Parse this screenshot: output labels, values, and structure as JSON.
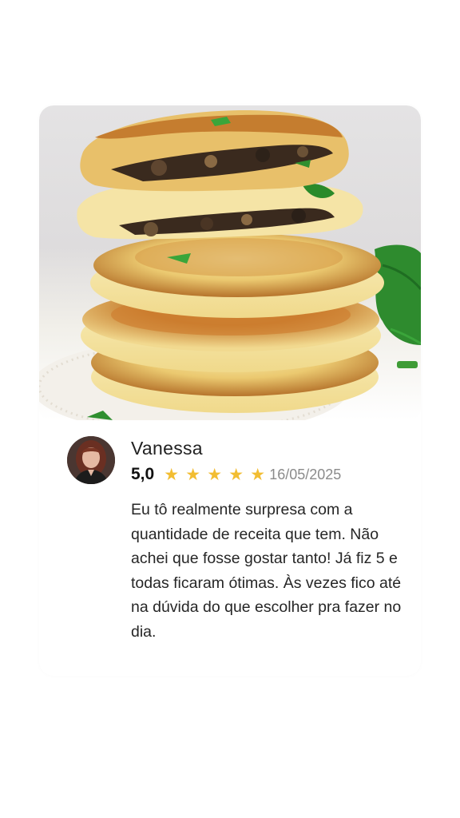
{
  "review_card": {
    "photo": {
      "subject": "stacked stuffed potato patties"
    },
    "reviewer": {
      "name": "Vanessa",
      "avatar_icon": "reviewer-avatar"
    },
    "rating": {
      "score_label": "5,0",
      "stars": 5,
      "max_stars": 5,
      "star_glyph": "★",
      "star_color": "#f2bd32"
    },
    "date": "16/05/2025",
    "text": "Eu tô realmente surpresa com a quantidade de receita que tem. Não achei que fosse gostar tanto! Já fiz 5 e todas ficaram ótimas. Às vezes fico até na dúvida do que escolher pra fazer no dia."
  },
  "colors": {
    "background": "#ffffff",
    "text": "#262626",
    "date": "#8b8b8b",
    "star": "#f2bd32"
  }
}
